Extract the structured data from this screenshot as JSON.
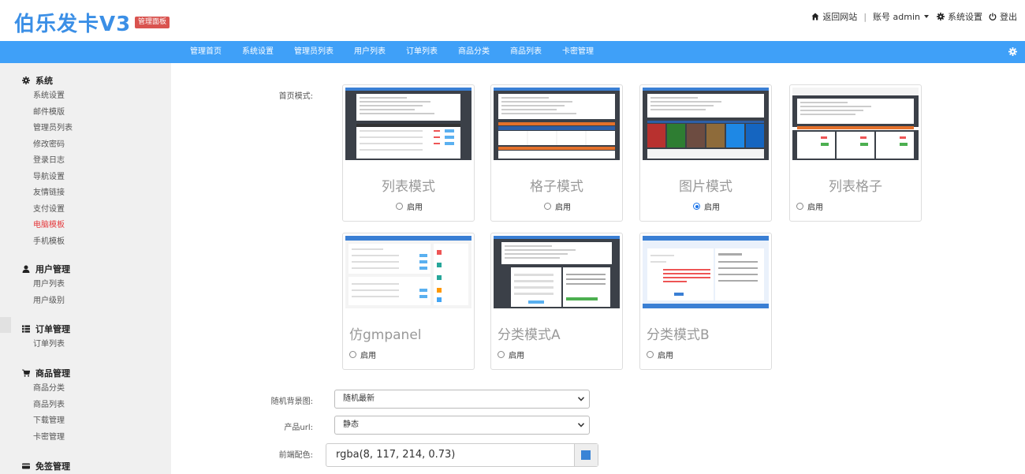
{
  "header": {
    "brand": "伯乐发卡V3",
    "badge": "管理面板",
    "back_site": "返回网站",
    "account": "账号 admin",
    "settings": "系统设置",
    "logout": "登出"
  },
  "nav": {
    "items": [
      "管理首页",
      "系统设置",
      "管理员列表",
      "用户列表",
      "订单列表",
      "商品分类",
      "商品列表",
      "卡密管理"
    ]
  },
  "sidebar": {
    "groups": [
      {
        "title": "系统",
        "items": [
          "系统设置",
          "邮件模版",
          "管理员列表",
          "修改密码",
          "登录日志",
          "导航设置",
          "友情链接",
          "支付设置",
          "电脑模板",
          "手机模板"
        ],
        "active": "电脑模板"
      },
      {
        "title": "用户管理",
        "items": [
          "用户列表",
          "用户级别"
        ]
      },
      {
        "title": "订单管理",
        "items": [
          "订单列表"
        ]
      },
      {
        "title": "商品管理",
        "items": [
          "商品分类",
          "商品列表",
          "下载管理",
          "卡密管理"
        ]
      },
      {
        "title": "免签管理",
        "items": []
      }
    ]
  },
  "main": {
    "home_mode_label": "首页模式:",
    "enable_label": "启用",
    "templates": [
      {
        "name": "列表模式",
        "checked": false
      },
      {
        "name": "格子模式",
        "checked": false
      },
      {
        "name": "图片模式",
        "checked": true
      },
      {
        "name": "列表格子",
        "checked": false
      },
      {
        "name": "仿gmpanel",
        "checked": false
      },
      {
        "name": "分类模式A",
        "checked": false
      },
      {
        "name": "分类模式B",
        "checked": false
      }
    ],
    "random_bg_label": "随机背景图:",
    "random_bg_value": "随机最新",
    "product_url_label": "产品url:",
    "product_url_value": "静态",
    "front_color_label": "前端配色:",
    "front_color_value": "rgba(8, 117, 214, 0.73)"
  },
  "colors": {
    "brand": "#3b8fe6",
    "nav_bg": "#3fa0f8",
    "active_link": "#e4393c",
    "badge": "#d9534f",
    "swatch": "#3a84d6"
  }
}
